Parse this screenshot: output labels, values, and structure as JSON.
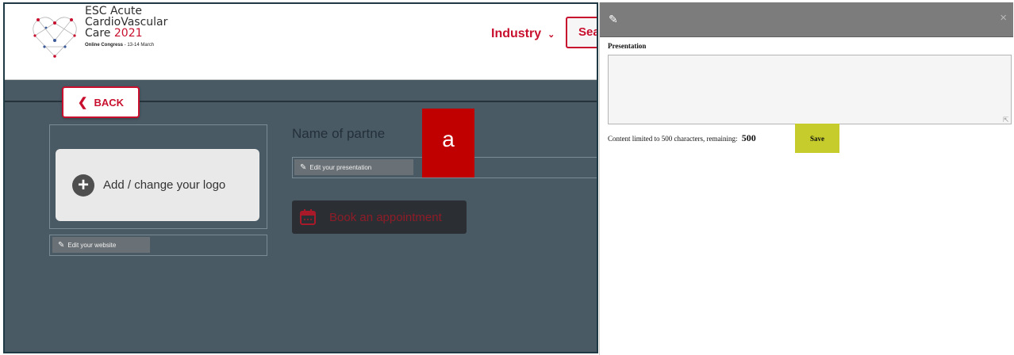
{
  "header": {
    "logo_line1": "ESC Acute",
    "logo_line2": "CardioVascular",
    "logo_line3_text": "Care",
    "logo_year": "2021",
    "logo_sub_bold": "Online Congress",
    "logo_sub_dates": " - 13-14 March",
    "industry_label": "Industry",
    "search_label": "Sea"
  },
  "back_label": "BACK",
  "logo_card_label": "Add / change your logo",
  "edit_website_label": "Edit your website",
  "partner_name": "Name of partne",
  "edit_presentation_label": "Edit your presentation",
  "book_label": "Book an appointment",
  "callout_letter": "a",
  "dialog": {
    "field_label": "Presentation",
    "textarea_value": "",
    "limit_text": "Content limited to 500 characters, remaining:",
    "remaining": "500",
    "save_label": "Save"
  },
  "colors": {
    "brand_red": "#c8102e",
    "app_bg": "#4a5a65",
    "callout_red": "#c00000",
    "save_green": "#c5cc2c",
    "dialog_bar": "#7c7c7c"
  },
  "icons": [
    "heart-logo-icon",
    "chevron-down-icon",
    "chevron-left-icon",
    "plus-circle-icon",
    "pencil-icon",
    "calendar-icon",
    "close-icon"
  ]
}
